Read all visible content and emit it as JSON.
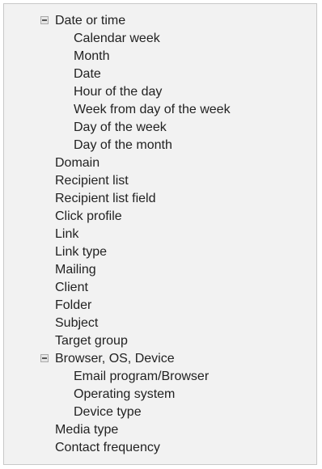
{
  "tree": {
    "date_group": {
      "label": "Date or time",
      "children": [
        "Calendar week",
        "Month",
        "Date",
        "Hour of the day",
        "Week from day of the week",
        "Day of the week",
        "Day of the month"
      ]
    },
    "items_a": [
      "Domain",
      "Recipient list",
      "Recipient list field",
      "Click profile",
      "Link",
      "Link type",
      "Mailing",
      "Client",
      "Folder",
      "Subject",
      "Target group"
    ],
    "browser_group": {
      "label": "Browser, OS, Device",
      "children": [
        "Email program/Browser",
        "Operating system",
        "Device type"
      ]
    },
    "items_b": [
      "Media type",
      "Contact frequency"
    ]
  }
}
